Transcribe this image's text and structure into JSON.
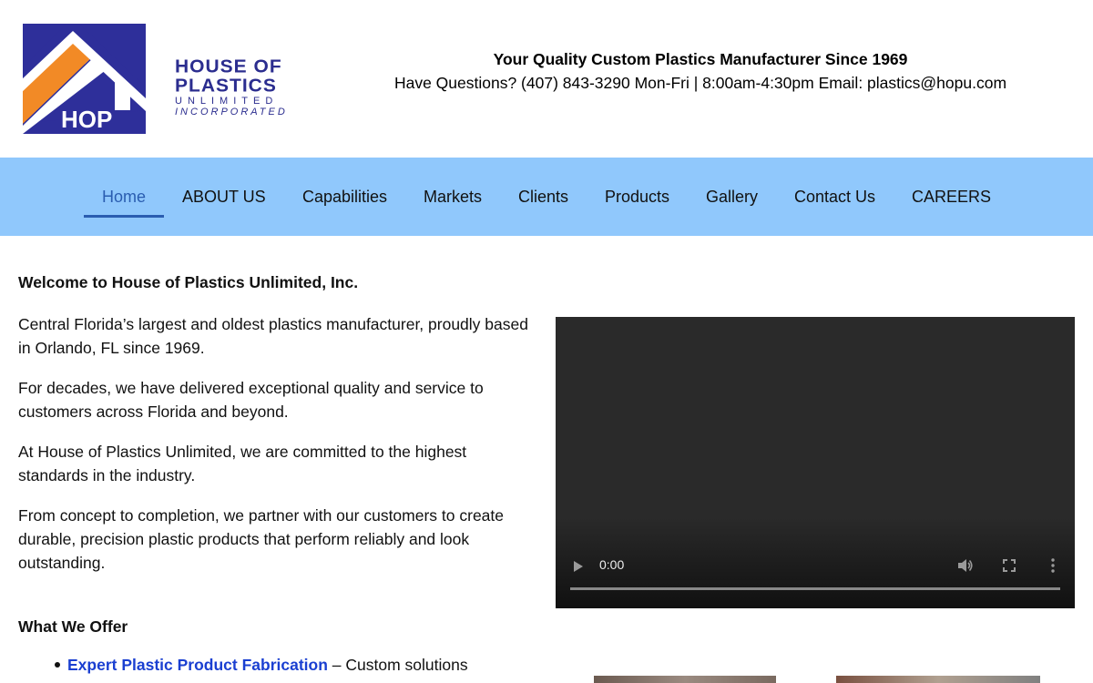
{
  "header": {
    "logo": {
      "mark_text": "HOP",
      "line1": "HOUSE OF",
      "line2": "PLASTICS",
      "line3": "UNLIMITED",
      "line4": "INCORPORATED",
      "brand_blue": "#2b2d8f",
      "brand_orange": "#f28a26"
    },
    "tagline": "Your Quality Custom Plastics Manufacturer Since 1969",
    "contact_line": "Have Questions? (407) 843-3290 Mon-Fri | 8:00am-4:30pm Email: plastics@hopu.com"
  },
  "nav": {
    "background": "#90c8fc",
    "active_color": "#2a5db0",
    "items": [
      {
        "label": "Home",
        "active": true
      },
      {
        "label": "ABOUT US",
        "active": false
      },
      {
        "label": "Capabilities",
        "active": false
      },
      {
        "label": "Markets",
        "active": false
      },
      {
        "label": "Clients",
        "active": false
      },
      {
        "label": "Products",
        "active": false
      },
      {
        "label": "Gallery",
        "active": false
      },
      {
        "label": "Contact Us",
        "active": false
      },
      {
        "label": "CAREERS",
        "active": false
      }
    ]
  },
  "main": {
    "welcome_heading": "Welcome to House of Plastics Unlimited, Inc.",
    "paragraphs": [
      "Central Florida’s largest and oldest plastics manufacturer, proudly based in Orlando, FL since 1969.",
      "For decades, we have delivered exceptional quality and service to customers across Florida and beyond.",
      "At House of Plastics Unlimited, we are committed to the highest standards in the industry.",
      "From concept to completion, we partner with our customers to create durable, precision plastic products that perform reliably and look outstanding."
    ],
    "offer_heading": "What We Offer",
    "offers": [
      {
        "link_text": "Expert Plastic Product Fabrication",
        "description": " – Custom solutions"
      }
    ]
  },
  "video": {
    "time": "0:00",
    "progress": 0.0,
    "icons": [
      "play-icon",
      "volume-icon",
      "fullscreen-icon",
      "more-options-icon"
    ]
  }
}
